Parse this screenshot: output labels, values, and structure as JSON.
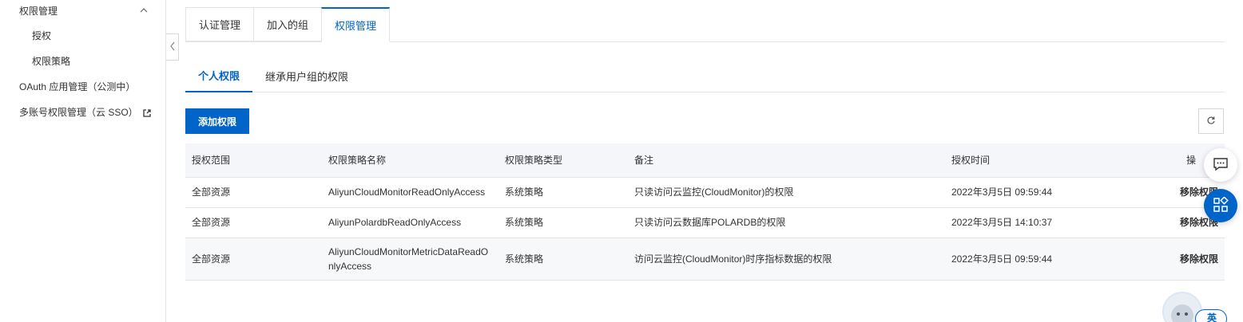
{
  "sidebar": {
    "group_label": "权限管理",
    "sub_items": [
      {
        "label": "授权"
      },
      {
        "label": "权限策略"
      }
    ],
    "items": [
      {
        "label": "OAuth 应用管理（公测中）"
      },
      {
        "label": "多账号权限管理（云 SSO）"
      }
    ]
  },
  "tabs": [
    {
      "label": "认证管理"
    },
    {
      "label": "加入的组"
    },
    {
      "label": "权限管理"
    }
  ],
  "subtabs": [
    {
      "label": "个人权限"
    },
    {
      "label": "继承用户组的权限"
    }
  ],
  "toolbar": {
    "add_label": "添加权限"
  },
  "table": {
    "headers": [
      "授权范围",
      "权限策略名称",
      "权限策略类型",
      "备注",
      "授权时间",
      "操"
    ],
    "rows": [
      {
        "scope": "全部资源",
        "policy": "AliyunCloudMonitorReadOnlyAccess",
        "type": "系统策略",
        "note": "只读访问云监控(CloudMonitor)的权限",
        "time": "2022年3月5日 09:59:44",
        "action": "移除权限"
      },
      {
        "scope": "全部资源",
        "policy": "AliyunPolardbReadOnlyAccess",
        "type": "系统策略",
        "note": "只读访问云数据库POLARDB的权限",
        "time": "2022年3月5日 14:10:37",
        "action": "移除权限"
      },
      {
        "scope": "全部资源",
        "policy": "AliyunCloudMonitorMetricDataReadOnlyAccess",
        "type": "系统策略",
        "note": "访问云监控(CloudMonitor)时序指标数据的权限",
        "time": "2022年3月5日 09:59:44",
        "action": "移除权限"
      }
    ]
  },
  "widgets": {
    "lang_label": "英"
  },
  "colors": {
    "accent": "#0064c8",
    "border": "#e3e4e6",
    "header_bg": "#f5f6fa"
  },
  "icons": [
    "chevron-up-icon",
    "chevron-left-icon",
    "external-link-icon",
    "refresh-icon",
    "chat-icon",
    "apps-icon",
    "assistant-avatar-icon"
  ]
}
